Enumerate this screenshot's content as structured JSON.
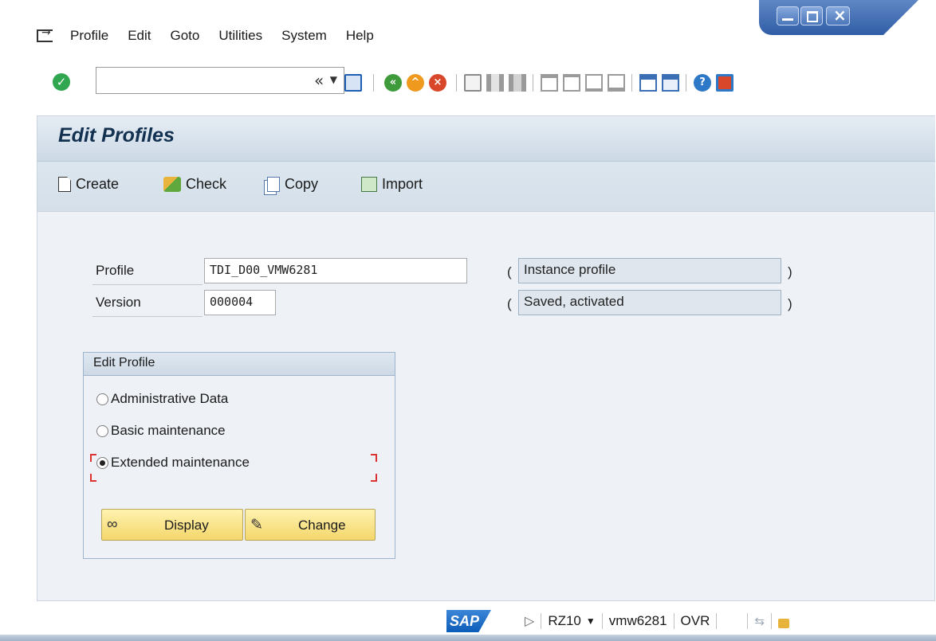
{
  "menu": {
    "items": [
      "Profile",
      "Edit",
      "Goto",
      "Utilities",
      "System",
      "Help"
    ]
  },
  "toolbar": {
    "command_field_value": "",
    "collapse_glyph": "«"
  },
  "page": {
    "title": "Edit Profiles",
    "actions": {
      "create": "Create",
      "check": "Check",
      "copy": "Copy",
      "import": "Import"
    }
  },
  "form": {
    "profile_label": "Profile",
    "profile_value": "TDI_D00_VMW6281",
    "profile_type": "Instance profile",
    "version_label": "Version",
    "version_value": "000004",
    "version_status": "Saved, activated",
    "open_paren": "(",
    "close_paren": ")"
  },
  "edit_profile": {
    "title": "Edit Profile",
    "options": [
      {
        "label": "Administrative Data",
        "selected": false
      },
      {
        "label": "Basic maintenance",
        "selected": false
      },
      {
        "label": "Extended maintenance",
        "selected": true
      }
    ],
    "display_button": "Display",
    "change_button": "Change"
  },
  "status": {
    "logo": "SAP",
    "transaction": "RZ10",
    "server": "vmw6281",
    "mode": "OVR"
  },
  "colors": {
    "accent": "#12304f",
    "panel_bg": "#eef2f6",
    "button_yellow": "#f4d66b",
    "focus_marker": "#dd3333"
  },
  "icons": {
    "window": [
      "minimize-icon",
      "maximize-icon",
      "close-icon"
    ],
    "toolbar": [
      "enter-check-icon",
      "save-icon",
      "back-icon",
      "exit-icon",
      "cancel-icon",
      "print-icon",
      "find-icon",
      "find-next-icon",
      "first-page-icon",
      "previous-page-icon",
      "next-page-icon",
      "last-page-icon",
      "create-session-icon",
      "shortcut-icon",
      "help-icon",
      "customize-layout-icon"
    ]
  }
}
